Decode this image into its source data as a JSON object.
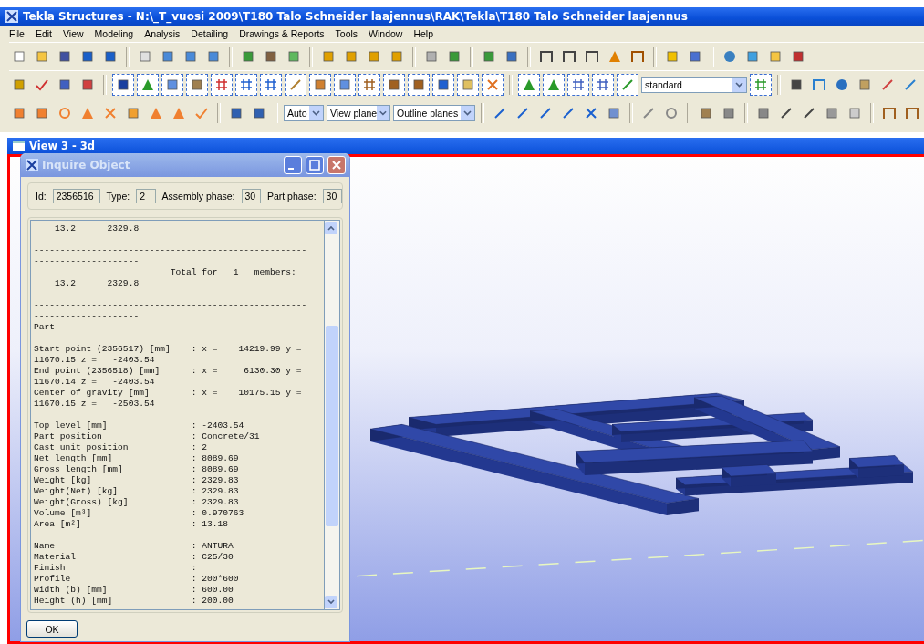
{
  "window": {
    "title": "Tekla Structures - N:\\_T_vuosi 2009\\T180 Talo Schneider laajennus\\RAK\\Tekla\\T180 Talo Schneider laajennus"
  },
  "menu": [
    "File",
    "Edit",
    "View",
    "Modeling",
    "Analysis",
    "Detailing",
    "Drawings & Reports",
    "Tools",
    "Window",
    "Help"
  ],
  "toolbar": {
    "filter_select": "standard",
    "dropdowns": [
      "Auto",
      "View plane",
      "Outline planes"
    ]
  },
  "view": {
    "title": "View 3 - 3d"
  },
  "dialog": {
    "title": "Inquire Object",
    "fields": [
      {
        "label": "Id:",
        "value": "2356516"
      },
      {
        "label": "Type:",
        "value": "2"
      },
      {
        "label": "Assembly phase:",
        "value": "30"
      },
      {
        "label": "Part phase:",
        "value": "30"
      }
    ],
    "report": [
      {
        "lines": [
          "    13.2      2329.8"
        ]
      },
      {
        "lines": [
          "----------------------------------------------------",
          "--------------------",
          "                          Total for   1   members:",
          "    13.2      2329.8"
        ]
      },
      {
        "lines": [
          "----------------------------------------------------",
          "--------------------",
          "Part"
        ]
      },
      {
        "lines": [
          "Start point (2356517) [mm]    : x =    14219.99 y =",
          "11670.15 z =   -2403.54",
          "End point (2356518) [mm]      : x =     6130.30 y =",
          "11670.14 z =   -2403.54",
          "Center of gravity [mm]        : x =    10175.15 y =",
          "11670.15 z =   -2503.54"
        ]
      },
      {
        "lines": [
          "Top level [mm]                : -2403.54",
          "Part position                 : Concrete/31",
          "Cast unit position            : 2",
          "Net length [mm]               : 8089.69",
          "Gross length [mm]             : 8089.69",
          "Weight [kg]                   : 2329.83",
          "Weight(Net) [kg]              : 2329.83",
          "Weight(Gross) [kg]            : 2329.83",
          "Volume [m³]                   : 0.970763",
          "Area [m²]                     : 13.18"
        ]
      },
      {
        "lines": [
          "Name                          : ANTURA",
          "Material                      : C25/30",
          "Finish                        :",
          "Profile                       : 200*600",
          "Width (b) [mm]                : 600.00",
          "Height (h) [mm]               : 200.00"
        ]
      }
    ],
    "ok_button": "OK"
  }
}
